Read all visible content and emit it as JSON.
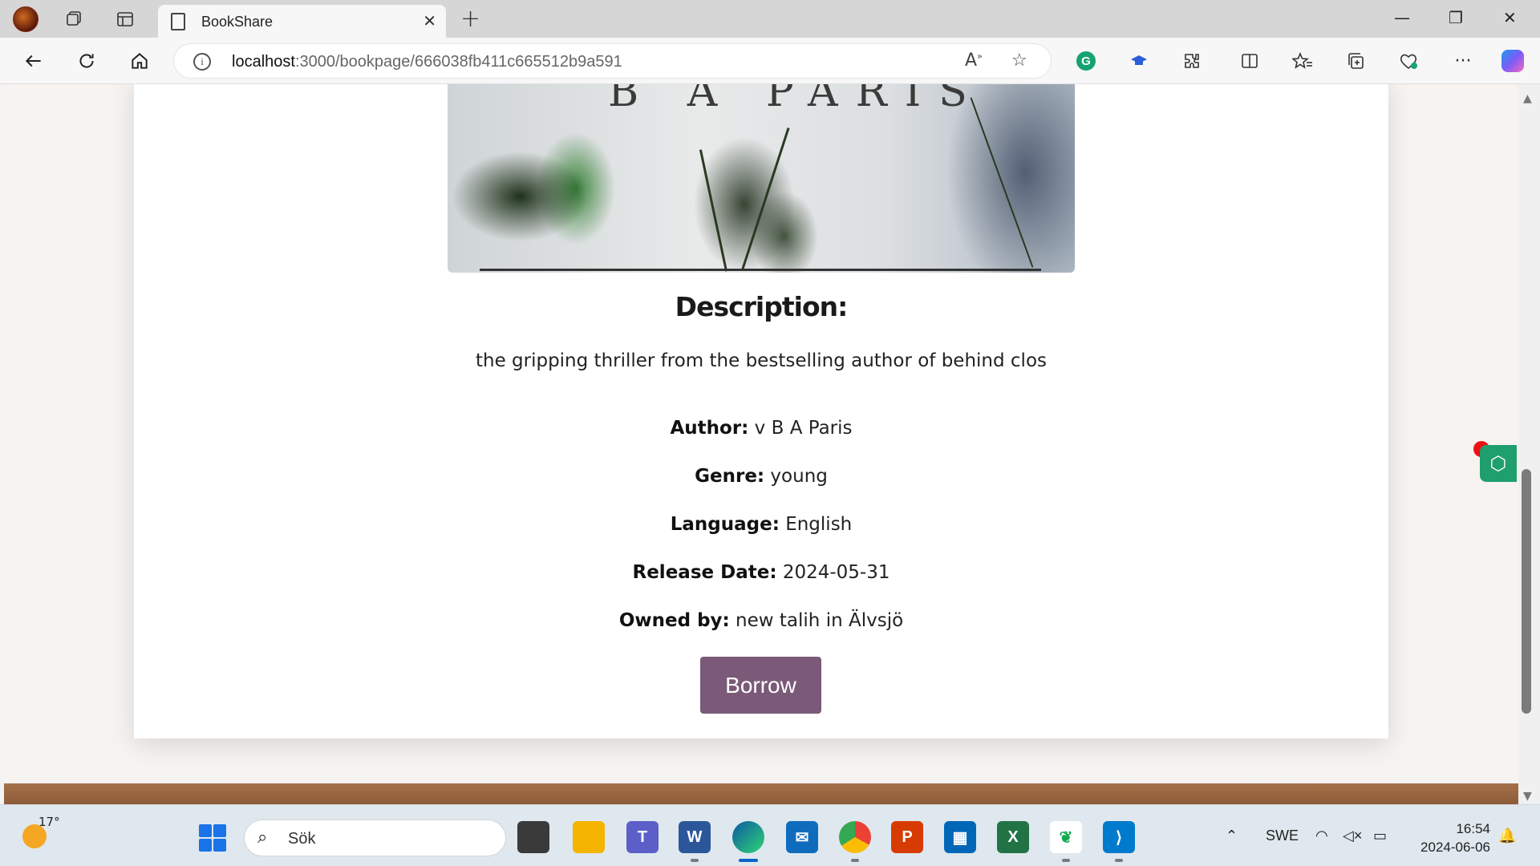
{
  "browser": {
    "tab_title": "BookShare",
    "url_host": "localhost",
    "url_path": ":3000/bookpage/666038fb411c665512b9a591"
  },
  "book": {
    "cover_text": "B A PARIS",
    "description_heading": "Description:",
    "description": "the gripping thriller from the bestselling author of behind clos",
    "fields": [
      {
        "label": "Author:",
        "value": " v B A Paris"
      },
      {
        "label": "Genre:",
        "value": " young"
      },
      {
        "label": "Language:",
        "value": " English"
      },
      {
        "label": "Release Date:",
        "value": " 2024-05-31"
      },
      {
        "label": "Owned by:",
        "value": " new talih in Älvsjö"
      }
    ],
    "borrow_label": "Borrow",
    "borrow_color": "#7a5a78"
  },
  "taskbar": {
    "temperature": "17°",
    "search_placeholder": "Sök",
    "language": "SWE",
    "time": "16:54",
    "date": "2024-06-06"
  }
}
